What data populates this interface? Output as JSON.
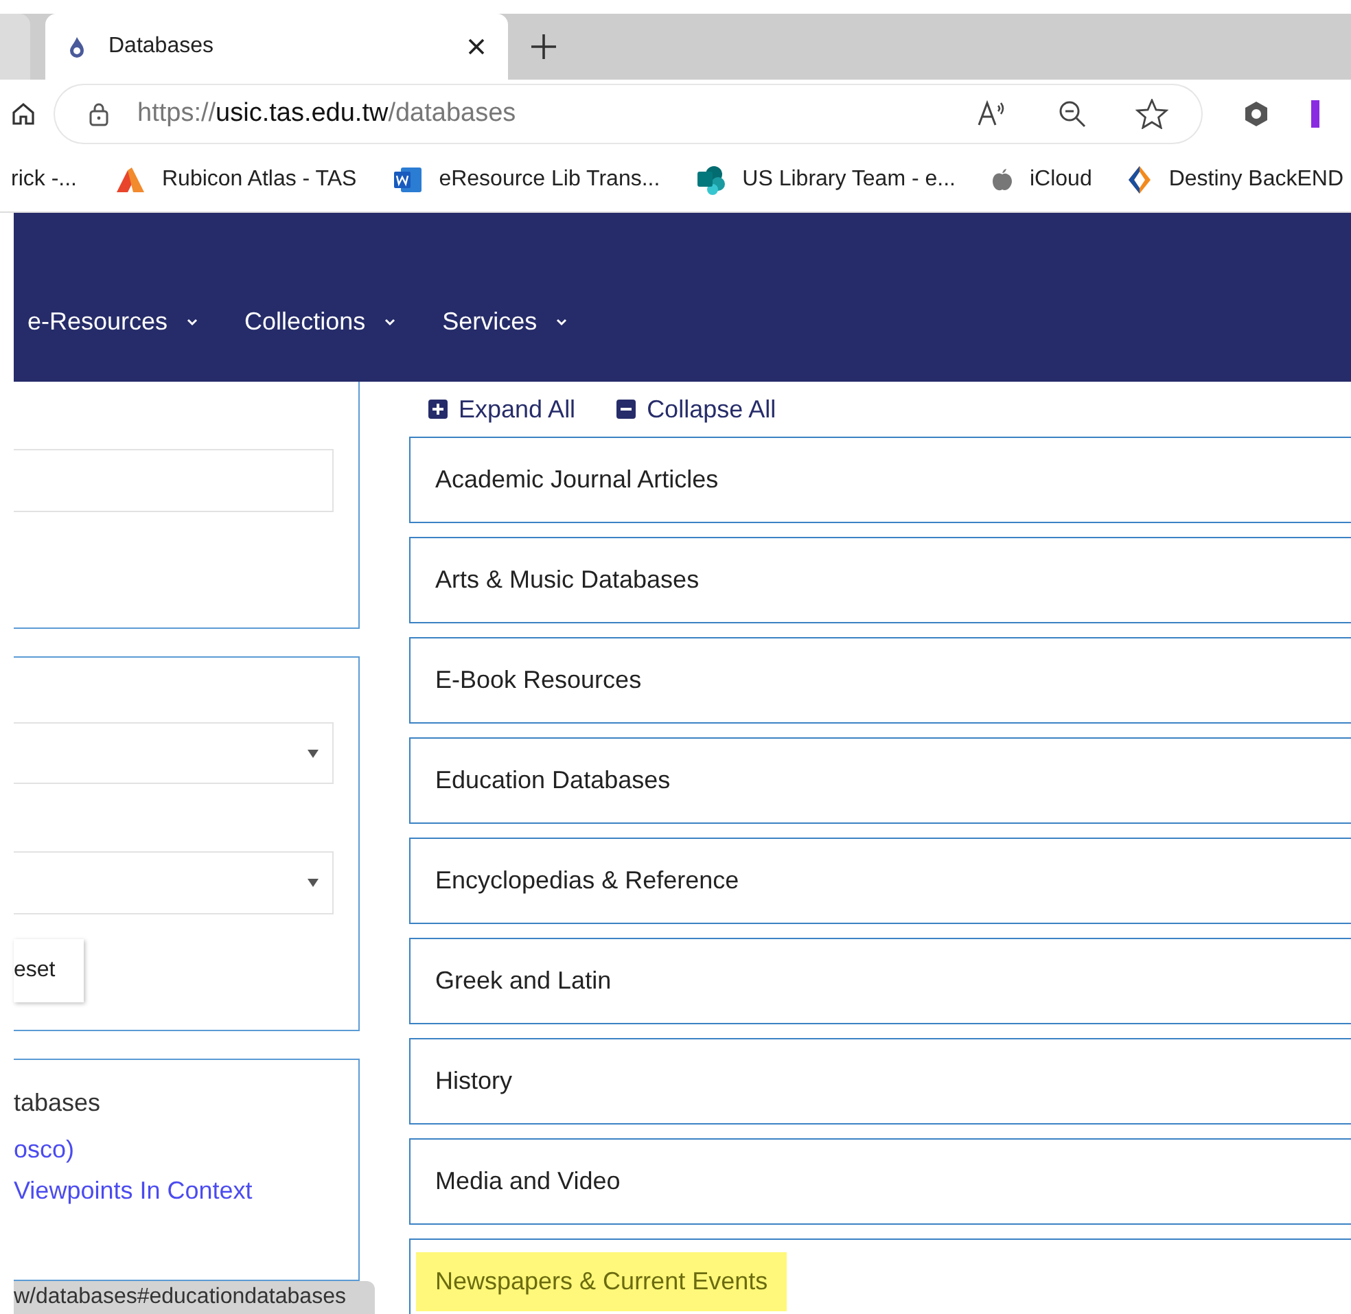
{
  "browser": {
    "tab": {
      "title": "Databases",
      "selected": true
    },
    "url": {
      "scheme": "https://",
      "host": "usic.tas.edu.tw",
      "path": "/databases"
    },
    "bookmarks": [
      {
        "label": "rick -...",
        "kind": "none"
      },
      {
        "label": "Rubicon Atlas - TAS",
        "kind": "atlas"
      },
      {
        "label": "eResource Lib Trans...",
        "kind": "word"
      },
      {
        "label": "US Library Team - e...",
        "kind": "sharepoint"
      },
      {
        "label": "iCloud",
        "kind": "apple"
      },
      {
        "label": "Destiny BackEND",
        "kind": "destiny"
      }
    ]
  },
  "nav": [
    {
      "label": "e-Resources"
    },
    {
      "label": "Collections"
    },
    {
      "label": "Services"
    }
  ],
  "sidebar": {
    "reset_button": "eset",
    "list_heading": "tabases",
    "links": [
      "osco)",
      "Viewpoints In Context"
    ]
  },
  "toolbar": {
    "expand": "Expand All",
    "collapse": "Collapse All"
  },
  "sections": [
    {
      "label": "Academic Journal Articles",
      "highlighted": false
    },
    {
      "label": "Arts & Music Databases",
      "highlighted": false
    },
    {
      "label": "E-Book Resources",
      "highlighted": false
    },
    {
      "label": "Education Databases",
      "highlighted": false
    },
    {
      "label": "Encyclopedias & Reference",
      "highlighted": false
    },
    {
      "label": "Greek and Latin",
      "highlighted": false
    },
    {
      "label": "History",
      "highlighted": false
    },
    {
      "label": "Media and Video",
      "highlighted": false
    },
    {
      "label": "Newspapers & Current Events",
      "highlighted": true
    }
  ],
  "status_bar": "w/databases#educationdatabases"
}
